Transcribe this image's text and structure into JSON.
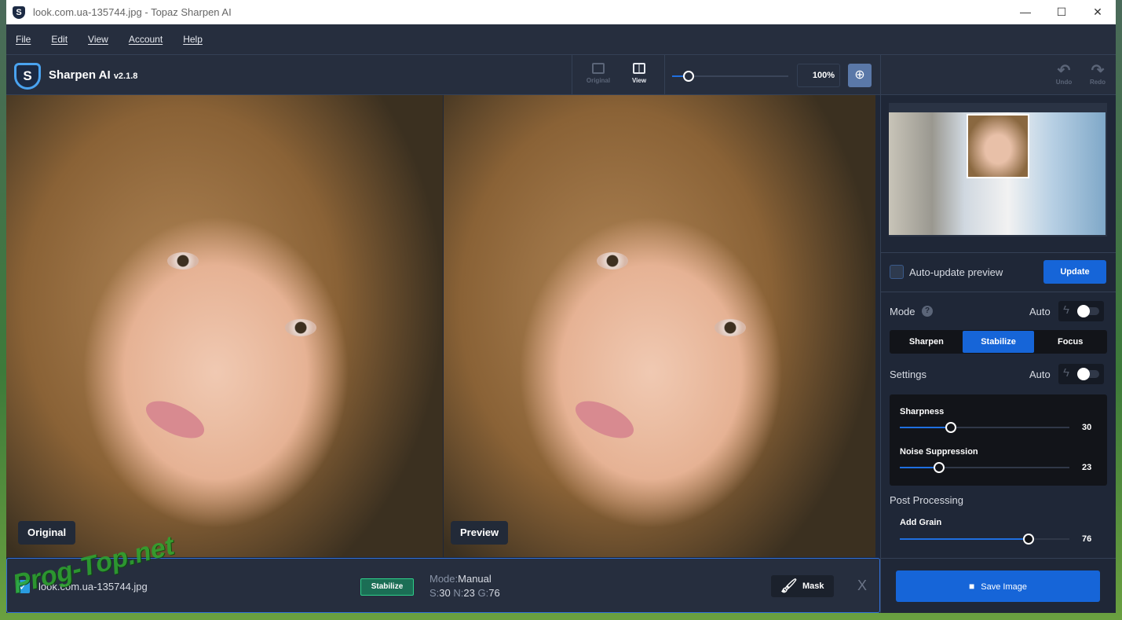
{
  "window": {
    "title": "look.com.ua-135744.jpg - Topaz Sharpen AI",
    "minimize": "—",
    "maximize": "☐",
    "close": "✕"
  },
  "menu": [
    "File",
    "Edit",
    "View",
    "Account",
    "Help"
  ],
  "app": {
    "name": "Sharpen AI",
    "version": "v2.1.8",
    "logo_letter": "S"
  },
  "toolbar": {
    "original": "Original",
    "view": "View",
    "zoom_value": "100%",
    "zoom_fraction": 0.03,
    "undo": "Undo",
    "redo": "Redo",
    "zoom_icon": "zoom-in-icon"
  },
  "preview": {
    "left_label": "Original",
    "right_label": "Preview"
  },
  "panel": {
    "auto_update": "Auto-update preview",
    "auto_update_checked": false,
    "update": "Update",
    "mode_label": "Mode",
    "auto": "Auto",
    "modes": [
      "Sharpen",
      "Stabilize",
      "Focus"
    ],
    "selected_mode": "Stabilize",
    "settings_label": "Settings",
    "sliders": [
      {
        "label": "Sharpness",
        "value": 30
      },
      {
        "label": "Noise Suppression",
        "value": 23
      }
    ],
    "post_processing": "Post Processing",
    "grain": {
      "label": "Add Grain",
      "value": 76
    },
    "save": "Save Image"
  },
  "bottom": {
    "filename": "look.com.ua-135744.jpg",
    "checked": true,
    "badge": "Stabilize",
    "mode_key": "Mode:",
    "mode_val": "Manual",
    "s_key": "S:",
    "s_val": "30",
    "n_key": "N:",
    "n_val": "23",
    "g_key": "G:",
    "g_val": "76",
    "mask": "Mask",
    "close": "X"
  },
  "watermark": "Prog-Top.net",
  "colors": {
    "accent": "#1665d8",
    "bg": "#1f2737",
    "badge": "#1b6e55"
  }
}
